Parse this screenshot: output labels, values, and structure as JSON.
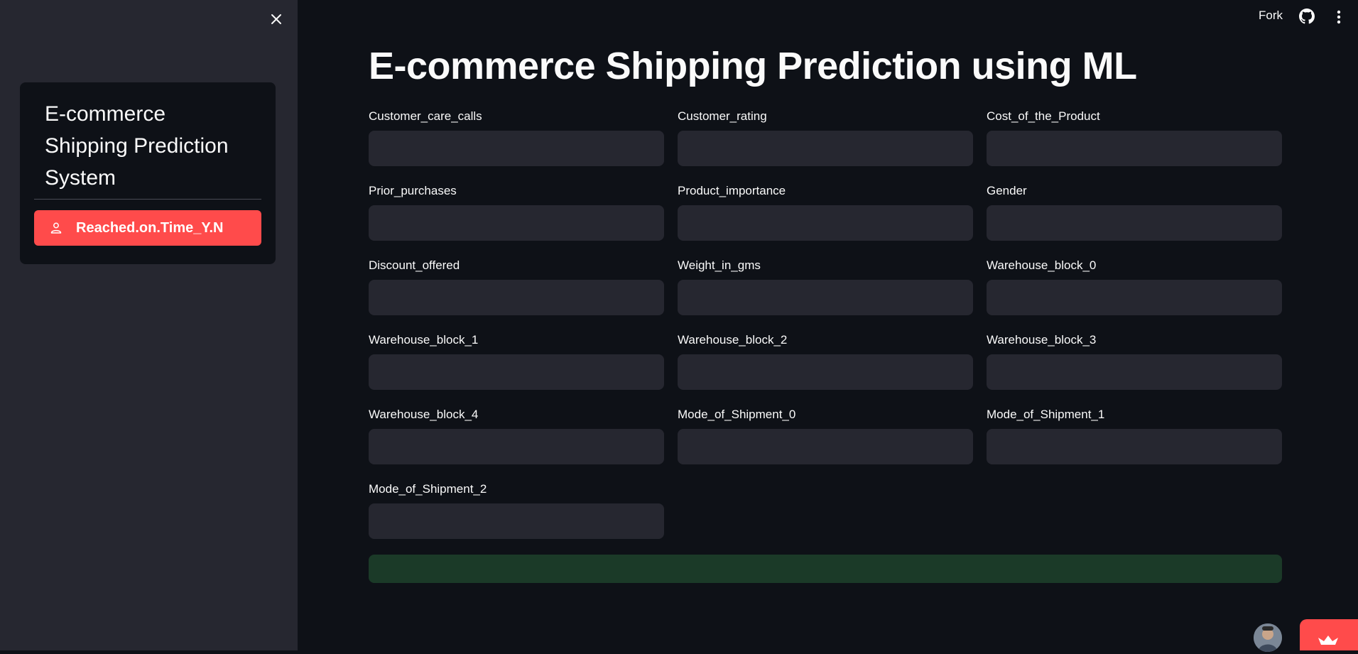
{
  "sidebar": {
    "title": " E-commerce\nShipping Prediction\nSystem",
    "button_label": "Reached.on.Time_Y.N"
  },
  "topbar": {
    "fork_label": "Fork"
  },
  "main": {
    "title": "E-commerce Shipping Prediction using ML",
    "fields": [
      {
        "label": "Customer_care_calls",
        "value": ""
      },
      {
        "label": "Customer_rating",
        "value": ""
      },
      {
        "label": "Cost_of_the_Product",
        "value": ""
      },
      {
        "label": "Prior_purchases",
        "value": ""
      },
      {
        "label": "Product_importance",
        "value": ""
      },
      {
        "label": "Gender",
        "value": ""
      },
      {
        "label": "Discount_offered",
        "value": ""
      },
      {
        "label": "Weight_in_gms",
        "value": ""
      },
      {
        "label": "Warehouse_block_0",
        "value": ""
      },
      {
        "label": "Warehouse_block_1",
        "value": ""
      },
      {
        "label": "Warehouse_block_2",
        "value": ""
      },
      {
        "label": "Warehouse_block_3",
        "value": ""
      },
      {
        "label": "Warehouse_block_4",
        "value": ""
      },
      {
        "label": "Mode_of_Shipment_0",
        "value": ""
      },
      {
        "label": "Mode_of_Shipment_1",
        "value": ""
      },
      {
        "label": "Mode_of_Shipment_2",
        "value": ""
      }
    ]
  },
  "icons": {
    "close": "close-icon",
    "user": "user-icon",
    "github": "github-icon",
    "menu": "kebab-menu-icon",
    "crown": "crown-icon"
  },
  "colors": {
    "background": "#0e1117",
    "sidebar": "#262730",
    "input": "#262730",
    "accent": "#ff4b4b",
    "success": "#1b3a28"
  }
}
